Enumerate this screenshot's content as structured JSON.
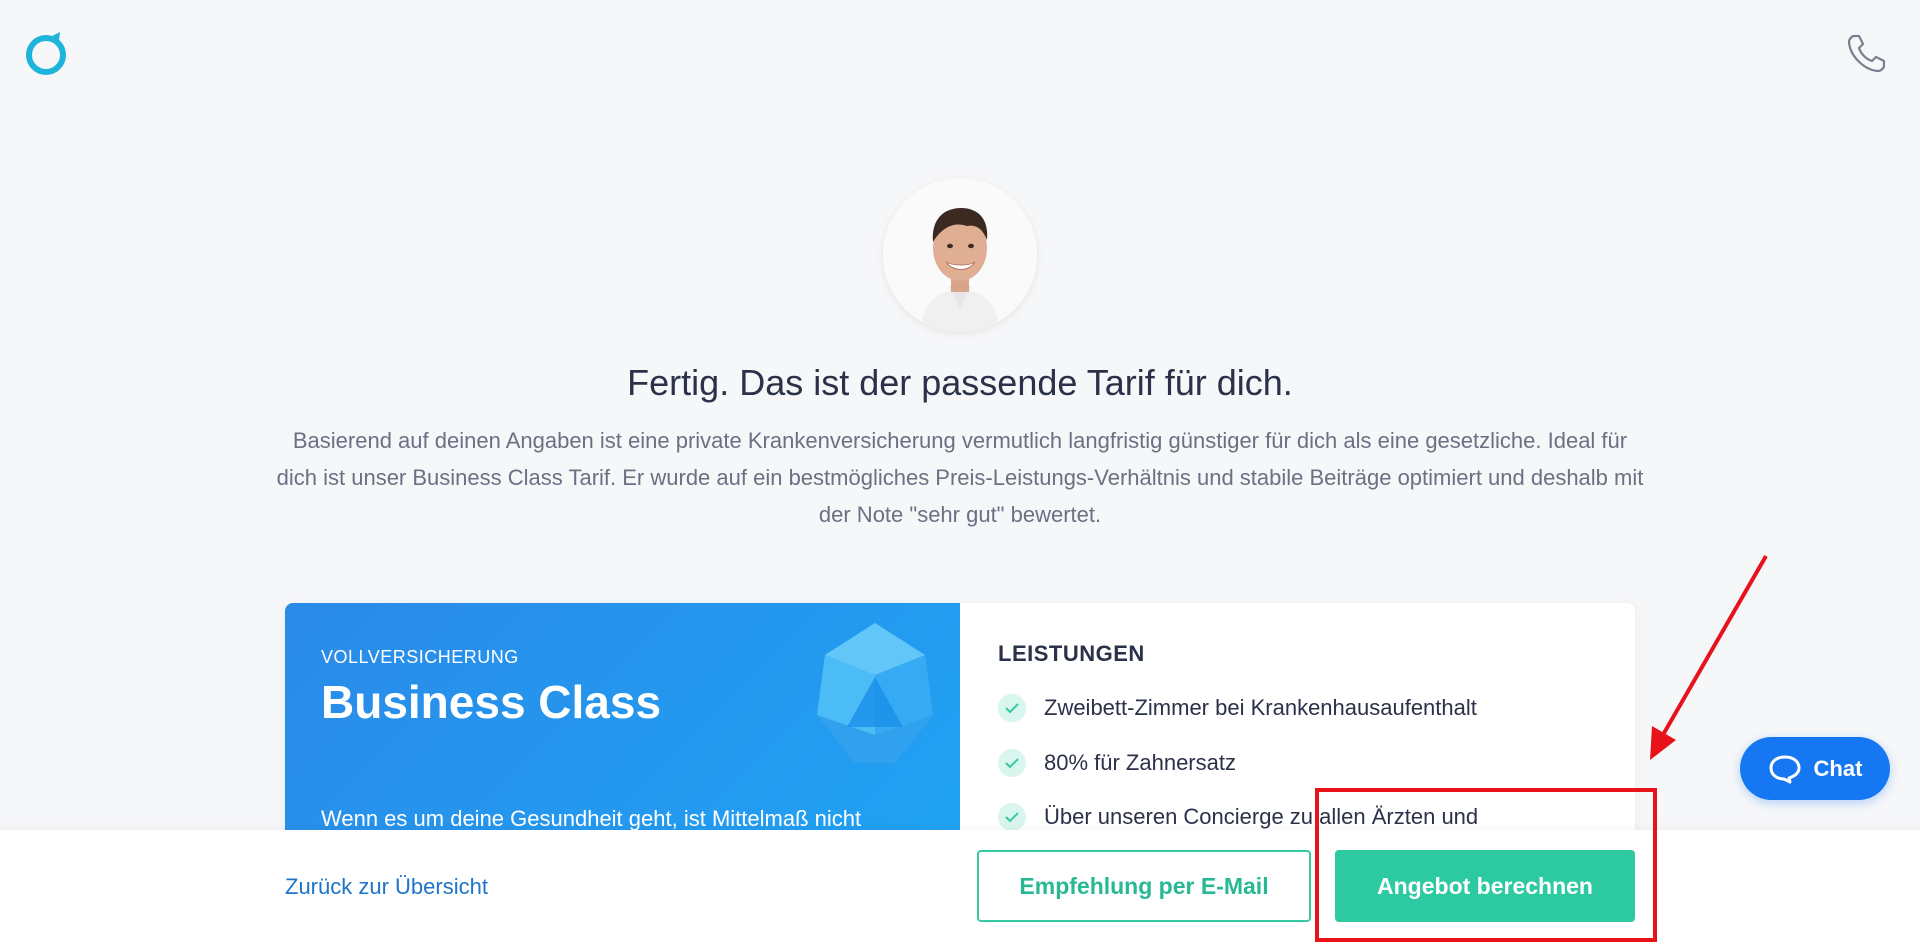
{
  "brand": {
    "logo_icon": "ring-logo-icon",
    "accent": "#1fb4dc"
  },
  "header": {
    "phone_icon": "phone-icon"
  },
  "headline": "Fertig. Das ist der passende Tarif für dich.",
  "intro": "Basierend auf deinen Angaben ist eine private Krankenversicherung vermutlich langfristig günstiger für dich als eine gesetzliche. Ideal für dich ist unser Business Class Tarif. Er wurde auf ein bestmögliches Preis-Leistungs-Verhältnis und stabile Beiträge optimiert und deshalb mit der Note \"sehr gut\" bewertet.",
  "card": {
    "kicker": "VOLLVERSICHERUNG",
    "title": "Business Class",
    "description": "Wenn es um deine Gesundheit geht, ist Mittelmaß nicht",
    "benefits_title": "LEISTUNGEN",
    "benefits": [
      "Zweibett-Zimmer bei Krankenhausaufenthalt",
      "80% für Zahnersatz",
      "Über unseren Concierge zu allen Ärzten und"
    ],
    "gradient": [
      "#2a8ae8",
      "#1fa4f4"
    ]
  },
  "footer": {
    "back_label": "Zurück zur Übersicht",
    "email_label": "Empfehlung per E-Mail",
    "offer_label": "Angebot berechnen"
  },
  "chat": {
    "label": "Chat",
    "icon": "chat-bubble-icon",
    "color": "#1677f2"
  },
  "annotation_color": "#e8121b"
}
